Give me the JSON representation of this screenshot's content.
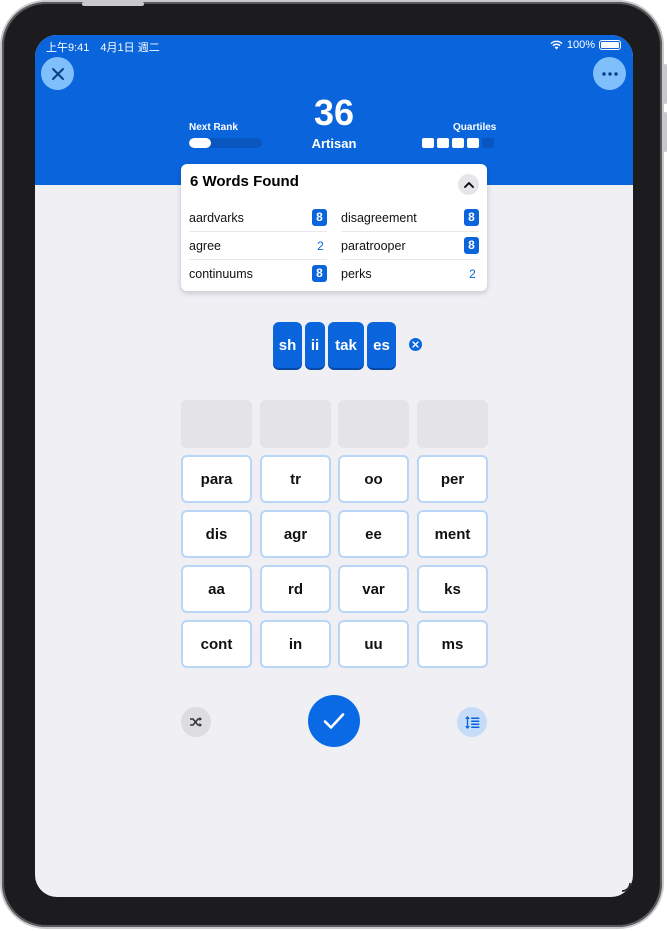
{
  "status_bar": {
    "time": "上午9:41　4月1日 週二",
    "battery": "100%"
  },
  "header": {
    "score": "36",
    "rank_name": "Artisan",
    "next_rank_label": "Next Rank",
    "next_rank_progress": 0.3,
    "quartiles_label": "Quartiles",
    "quartiles_filled": 4,
    "quartiles_total": 5
  },
  "found": {
    "title": "6 Words Found",
    "words": [
      {
        "word": "aardvarks",
        "points": "8",
        "quartile": true
      },
      {
        "word": "agree",
        "points": "2",
        "quartile": false
      },
      {
        "word": "continuums",
        "points": "8",
        "quartile": true
      },
      {
        "word": "disagreement",
        "points": "8",
        "quartile": true
      },
      {
        "word": "paratrooper",
        "points": "8",
        "quartile": true
      },
      {
        "word": "perks",
        "points": "2",
        "quartile": false
      }
    ]
  },
  "current_word": [
    "sh",
    "ii",
    "tak",
    "es"
  ],
  "tiles": [
    "para",
    "tr",
    "oo",
    "per",
    "dis",
    "agr",
    "ee",
    "ment",
    "aa",
    "rd",
    "var",
    "ks",
    "cont",
    "in",
    "uu",
    "ms"
  ],
  "icons": {
    "close": "close-icon",
    "more": "ellipsis-icon",
    "collapse": "chevron-up-icon",
    "clear": "clear-x-icon",
    "shuffle": "shuffle-icon",
    "submit": "checkmark-icon",
    "sort": "sort-list-icon"
  },
  "colors": {
    "accent": "#0a65dd",
    "header_bg": "#0a65dd",
    "screen_bg": "#efeff4",
    "tile_border": "#b9d6f7",
    "slot_bg": "#e4e4e8"
  }
}
